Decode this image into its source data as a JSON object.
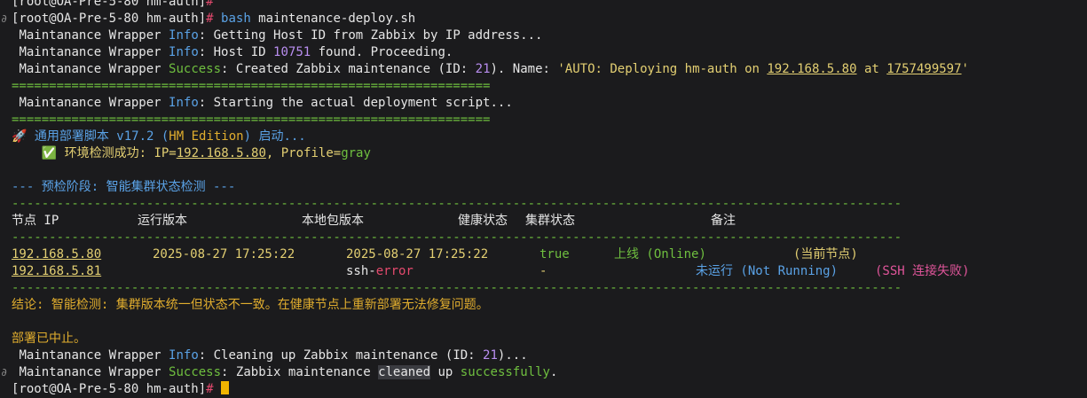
{
  "terminal": {
    "prompt_line_0": "[root@OA-Pre-5-80 hm-auth]",
    "prompt_line_0_hash": "#",
    "prompt_line_1": "[root@OA-Pre-5-80 hm-auth]",
    "prompt_line_1_hash": "#",
    "command_bash": "bash",
    "command_rest": " maintenance-deploy.sh",
    "prefix": "Maintanance Wrapper",
    "info": "Info",
    "success": "Success",
    "l2_text": ": Getting Host ID from Zabbix by IP address...",
    "l3_a": ": Host ID ",
    "l3_num": "10751",
    "l3_b": " found. Proceeding.",
    "l4_a": ": Created Zabbix maintenance (",
    "l4_id": "ID: ",
    "l4_num": "21",
    "l4_b": "). Name: ",
    "l4_q1": "'AUTO: Deploying hm-auth on ",
    "l4_ip": "192.168.5.80",
    "l4_at": " at ",
    "l4_ts": "1757499597",
    "l4_q2": "'",
    "separator": "================================================================",
    "l6_text": ": Starting the actual deployment script...",
    "banner_rocket": "🚀",
    "banner_a": " 通用部署脚本 v17.2 (",
    "banner_b": "HM Edition",
    "banner_c": ") 启动...",
    "env_check": "✅",
    "env_a": " 环境检测成功: IP=",
    "env_ip": "192.168.5.80",
    "env_b": ", Profile=",
    "env_profile": "gray",
    "phase_title": "--- 预检阶段: 智能集群状态检测 ---",
    "dash_line": "-----------------------------------------------------------------------------------------------------------------------",
    "table": {
      "headers": [
        "节点 IP",
        "运行版本",
        "本地包版本",
        "健康状态",
        "集群状态",
        "备注"
      ],
      "rows": [
        {
          "ip": "192.168.5.80",
          "running": "2025-08-27 17:25:22",
          "local": "2025-08-27 17:25:22",
          "health": "true",
          "cluster_a": "上线 (",
          "cluster_b": "Online",
          "cluster_c": ")",
          "note": "(当前节点)"
        },
        {
          "ip": "192.168.5.81",
          "running": "",
          "local_a": "ssh-",
          "local_b": "error",
          "health": "-",
          "cluster_a": "未运行 (",
          "cluster_b": "Not Running",
          "cluster_c": ")",
          "note": "(SSH 连接失败)"
        }
      ]
    },
    "conclusion": "结论: 智能检测: 集群版本统一但状态不一致。在健康节点上重新部署无法修复问题。",
    "aborted": "部署已中止。",
    "l18_a": ": Cleaning up Zabbix maintenance (",
    "l18_id": "ID: ",
    "l18_num": "21",
    "l18_b": ")...",
    "l19_a": ": Zabbix maintenance ",
    "l19_cleaned": "cleaned",
    "l19_b": " up ",
    "l19_succ": "successfully",
    "l19_c": ".",
    "last_prompt": "[root@OA-Pre-5-80 hm-auth]",
    "last_prompt_hash": "#",
    "gutter_mark": "∂"
  }
}
